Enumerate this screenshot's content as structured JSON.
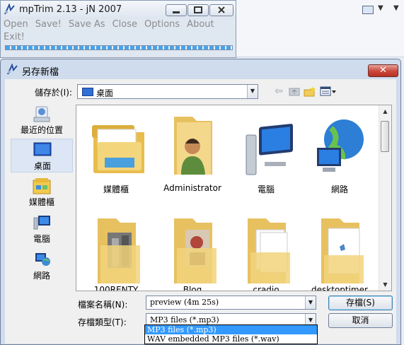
{
  "mptrim": {
    "title": "mpTrim 2.13 - jN 2007",
    "menu": [
      "Open",
      "Save!",
      "Save As",
      "Close",
      "Options",
      "About",
      "Exit!"
    ]
  },
  "dialog": {
    "title": "另存新檔",
    "close_glyph": "✕",
    "save_in_label": "儲存於(I):",
    "save_in_value": "桌面",
    "places": [
      "最近的位置",
      "桌面",
      "媒體櫃",
      "電腦",
      "網路"
    ],
    "selected_place": "桌面",
    "files": [
      "媒體櫃",
      "Administrator",
      "電腦",
      "網路",
      "100RENTY",
      "Blog",
      "cradio",
      "desktoptimer"
    ],
    "file_name_label": "檔案名稱(N):",
    "file_name_value": "preview (4m 25s)",
    "file_type_label": "存檔類型(T):",
    "file_type_value": "MP3 files (*.mp3)",
    "file_type_options": [
      "MP3 files (*.mp3)",
      "WAV embedded MP3 files (*.wav)"
    ],
    "save_button": "存檔(S)",
    "cancel_button": "取消"
  },
  "colors": {
    "title_bar": "#cfdced",
    "close_red": "#c9473a",
    "highlight": "#3399ff"
  }
}
